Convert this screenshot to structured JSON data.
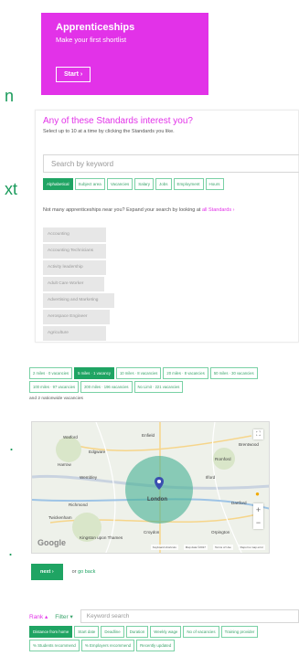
{
  "side_fragments": [
    "n",
    "xt",
    ".",
    "."
  ],
  "promo": {
    "title": "Apprenticeships",
    "subtitle": "Make your first shortlist",
    "start_label": "Start ›"
  },
  "standards": {
    "question": "Any of these Standards interest you?",
    "instruction": "Select up to 10 at a time by clicking the Standards you like.",
    "search_placeholder": "Search by keyword",
    "tabs": [
      {
        "label": "Alphabetical",
        "active": true
      },
      {
        "label": "Subject area",
        "active": false
      },
      {
        "label": "Vacancies",
        "active": false
      },
      {
        "label": "Salary",
        "active": false
      },
      {
        "label": "Jobs",
        "active": false
      },
      {
        "label": "Employment",
        "active": false
      },
      {
        "label": "Hours",
        "active": false
      }
    ],
    "hint_text": "Not many apprenticeships near you? Expand your search by looking at",
    "hint_link": "all Standards ›",
    "items": [
      "Accounting",
      "Accounting Technicians",
      "Activity leadership",
      "Adult Care Worker",
      "Advertising and Marketing",
      "Aerospace Engineer",
      "Agriculture"
    ]
  },
  "distance": {
    "chips": [
      {
        "label": "2 miles · 0 vacancies",
        "active": false
      },
      {
        "label": "5 miles · 1 vacancy",
        "active": true
      },
      {
        "label": "10 miles · 8 vacancies",
        "active": false
      },
      {
        "label": "20 miles · 8 vacancies",
        "active": false
      },
      {
        "label": "50 miles · 30 vacancies",
        "active": false
      },
      {
        "label": "100 miles · 97 vacancies",
        "active": false
      },
      {
        "label": "200 miles · 196 vacancies",
        "active": false
      },
      {
        "label": "No Limit · 221 vacancies",
        "active": false
      }
    ],
    "nationwide": "and 2 nationwide vacancies"
  },
  "map": {
    "places": [
      "Watford",
      "Enfield",
      "Edgware",
      "Harrow",
      "Wembley",
      "Ilford",
      "Romford",
      "Brentwood",
      "London",
      "Richmond",
      "Twickenham",
      "Croydon",
      "Dartford",
      "Orpington",
      "Kingston upon Thames"
    ],
    "google_label": "Google",
    "footer": [
      "Keyboard shortcuts",
      "Map data ©2017",
      "Terms of Use",
      "Report a map error"
    ]
  },
  "next_label": "next ›",
  "go_back_prefix": "or",
  "go_back_link": "go back",
  "rank_bar": {
    "rank_label": "Rank ▴",
    "filter_label": "Filter ▾",
    "keyword_placeholder": "Keyword search",
    "chips": [
      {
        "label": "Distance from home",
        "active": true
      },
      {
        "label": "Start date",
        "active": false
      },
      {
        "label": "Deadline",
        "active": false
      },
      {
        "label": "Duration",
        "active": false
      },
      {
        "label": "Weekly wage",
        "active": false
      },
      {
        "label": "No of vacancies",
        "active": false
      },
      {
        "label": "Training provider",
        "active": false
      },
      {
        "label": "% Students recommend",
        "active": false
      },
      {
        "label": "% Employers recommend",
        "active": false
      },
      {
        "label": "Recently updated",
        "active": false
      }
    ]
  },
  "colors": {
    "magenta": "#e232e8",
    "green": "#1fa463",
    "side_green": "#1a9b5b"
  }
}
